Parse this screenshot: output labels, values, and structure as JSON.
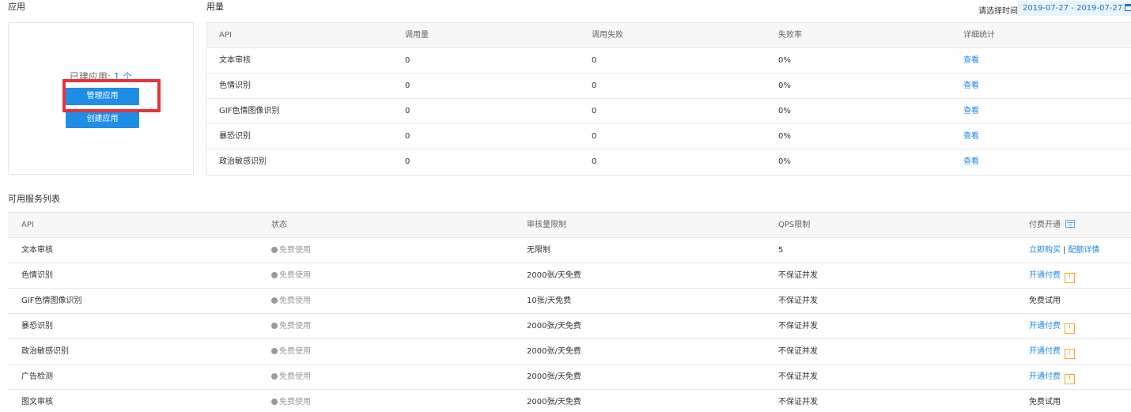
{
  "sections": {
    "apps_title": "应用",
    "usage_title": "用量",
    "services_title": "可用服务列表"
  },
  "date_filter": {
    "label": "请选择时间段",
    "range": "2019-07-27 - 2019-07-27"
  },
  "app_card": {
    "count_label": "已建应用:",
    "count_value": "1",
    "count_unit": "个",
    "manage_button": "管理应用",
    "create_button": "创建应用"
  },
  "usage_table": {
    "headers": [
      "API",
      "调用量",
      "调用失败",
      "失败率",
      "详细统计"
    ],
    "rows": [
      {
        "api": "文本审核",
        "calls": "0",
        "failures": "0",
        "rate": "0%",
        "detail": "查看"
      },
      {
        "api": "色情识别",
        "calls": "0",
        "failures": "0",
        "rate": "0%",
        "detail": "查看"
      },
      {
        "api": "GIF色情图像识别",
        "calls": "0",
        "failures": "0",
        "rate": "0%",
        "detail": "查看"
      },
      {
        "api": "暴恐识别",
        "calls": "0",
        "failures": "0",
        "rate": "0%",
        "detail": "查看"
      },
      {
        "api": "政治敏感识别",
        "calls": "0",
        "failures": "0",
        "rate": "0%",
        "detail": "查看"
      }
    ]
  },
  "services_table": {
    "headers": [
      "API",
      "状态",
      "审核量限制",
      "QPS限制",
      "付费开通"
    ],
    "rows": [
      {
        "api": "文本审核",
        "status": "免费使用",
        "limit": "无限制",
        "qps": "5",
        "pay_a": "立即购买",
        "pay_sep": "|",
        "pay_b": "配额详情"
      },
      {
        "api": "色情识别",
        "status": "免费使用",
        "limit": "2000张/天免费",
        "qps": "不保证并发",
        "pay_a": "开通付费",
        "warn": "!"
      },
      {
        "api": "GIF色情图像识别",
        "status": "免费使用",
        "limit": "10张/天免费",
        "qps": "不保证并发",
        "pay_text": "免费试用"
      },
      {
        "api": "暴恐识别",
        "status": "免费使用",
        "limit": "2000张/天免费",
        "qps": "不保证并发",
        "pay_a": "开通付费",
        "warn": "!"
      },
      {
        "api": "政治敏感识别",
        "status": "免费使用",
        "limit": "2000张/天免费",
        "qps": "不保证并发",
        "pay_a": "开通付费",
        "warn": "!"
      },
      {
        "api": "广告检测",
        "status": "免费使用",
        "limit": "2000张/天免费",
        "qps": "不保证并发",
        "pay_a": "开通付费",
        "warn": "!"
      },
      {
        "api": "图文审核",
        "status": "免费使用",
        "limit": "2000张/天免费",
        "qps": "不保证并发",
        "pay_text": "免费试用"
      }
    ]
  }
}
